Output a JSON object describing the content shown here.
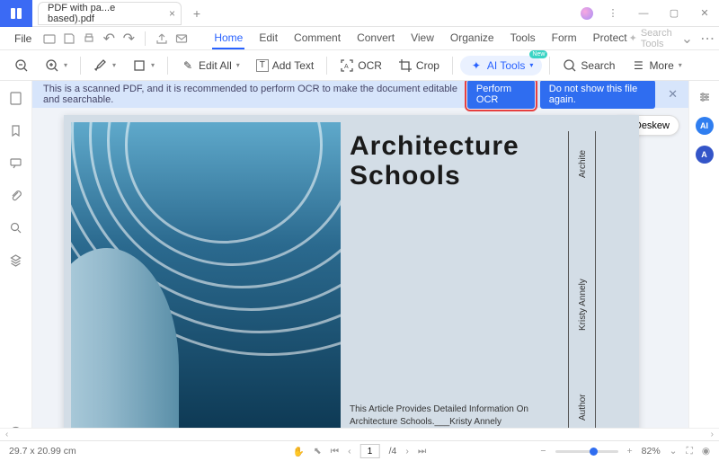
{
  "titlebar": {
    "tab_name": "PDF with pa...e based).pdf"
  },
  "menubar": {
    "file": "File",
    "tabs": [
      "Home",
      "Edit",
      "Comment",
      "Convert",
      "View",
      "Organize",
      "Tools",
      "Form",
      "Protect"
    ],
    "active_index": 0,
    "search_tools": "Search Tools"
  },
  "toolbar": {
    "edit_all": "Edit All",
    "add_text": "Add Text",
    "ocr": "OCR",
    "crop": "Crop",
    "ai_tools": "AI Tools",
    "ai_badge": "New",
    "search": "Search",
    "more": "More"
  },
  "banner": {
    "message": "This is a scanned PDF, and it is recommended to perform OCR to make the document editable and searchable.",
    "perform": "Perform OCR",
    "hide": "Do not show this file again."
  },
  "deskew": {
    "label": "Deskew"
  },
  "document": {
    "title_line1": "Architecture",
    "title_line2": "Schools",
    "sub": "This Article Provides Detailed Information On Architecture Schools.___Kristy Annely",
    "side_archite": "Archite",
    "side_author": "Author",
    "side_kristy": "Kristy Annely"
  },
  "status": {
    "dimensions": "29.7 x 20.99 cm",
    "page_current": "1",
    "page_total": "/4",
    "zoom_pct": "82%"
  }
}
